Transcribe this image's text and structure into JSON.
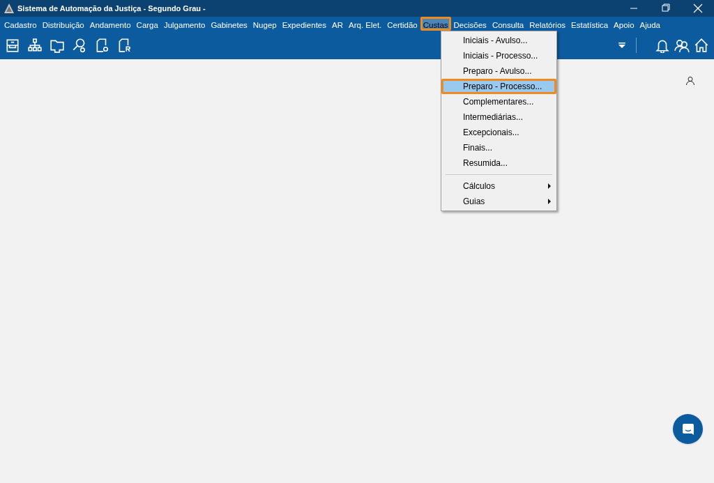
{
  "window": {
    "title": "Sistema de Automação da Justiça - Segundo Grau -"
  },
  "menubar": [
    {
      "label": "Cadastro",
      "selected": false,
      "highlighted": false
    },
    {
      "label": "Distribuição",
      "selected": false,
      "highlighted": false
    },
    {
      "label": "Andamento",
      "selected": false,
      "highlighted": false
    },
    {
      "label": "Carga",
      "selected": false,
      "highlighted": false
    },
    {
      "label": "Julgamento",
      "selected": false,
      "highlighted": false
    },
    {
      "label": "Gabinetes",
      "selected": false,
      "highlighted": false
    },
    {
      "label": "Nugep",
      "selected": false,
      "highlighted": false
    },
    {
      "label": "Expedientes",
      "selected": false,
      "highlighted": false
    },
    {
      "label": "AR",
      "selected": false,
      "highlighted": false
    },
    {
      "label": "Arq. Elet.",
      "selected": false,
      "highlighted": false
    },
    {
      "label": "Certidão",
      "selected": false,
      "highlighted": false
    },
    {
      "label": "Custas",
      "selected": true,
      "highlighted": true
    },
    {
      "label": "Decisões",
      "selected": false,
      "highlighted": false
    },
    {
      "label": "Consulta",
      "selected": false,
      "highlighted": false
    },
    {
      "label": "Relatórios",
      "selected": false,
      "highlighted": false
    },
    {
      "label": "Estatística",
      "selected": false,
      "highlighted": false
    },
    {
      "label": "Apoio",
      "selected": false,
      "highlighted": false
    },
    {
      "label": "Ajuda",
      "selected": false,
      "highlighted": false
    }
  ],
  "toolbar": {
    "left": [
      {
        "kind": "tray"
      },
      {
        "kind": "tree"
      },
      {
        "kind": "folder"
      },
      {
        "kind": "search-gear"
      },
      {
        "kind": "doc-o"
      },
      {
        "kind": "doc-r"
      }
    ],
    "right": [
      {
        "kind": "bell"
      },
      {
        "kind": "users"
      },
      {
        "kind": "home"
      }
    ]
  },
  "dropdown": [
    {
      "label": "Iniciais - Avulso...",
      "kind": "item",
      "selected": false,
      "highlighted": false,
      "separator_before": false
    },
    {
      "label": "Iniciais - Processo...",
      "kind": "item",
      "selected": false,
      "highlighted": false,
      "separator_before": false
    },
    {
      "label": "Preparo - Avulso...",
      "kind": "item",
      "selected": false,
      "highlighted": false,
      "separator_before": false
    },
    {
      "label": "Preparo - Processo...",
      "kind": "item",
      "selected": true,
      "highlighted": true,
      "separator_before": false
    },
    {
      "label": "Complementares...",
      "kind": "item",
      "selected": false,
      "highlighted": false,
      "separator_before": false
    },
    {
      "label": "Intermediárias...",
      "kind": "item",
      "selected": false,
      "highlighted": false,
      "separator_before": false
    },
    {
      "label": "Excepcionais...",
      "kind": "item",
      "selected": false,
      "highlighted": false,
      "separator_before": false
    },
    {
      "label": "Finais...",
      "kind": "item",
      "selected": false,
      "highlighted": false,
      "separator_before": false
    },
    {
      "label": "Resumida...",
      "kind": "item",
      "selected": false,
      "highlighted": false,
      "separator_before": false
    },
    {
      "label": "Cálculos",
      "kind": "submenu",
      "selected": false,
      "highlighted": false,
      "separator_before": true
    },
    {
      "label": "Guias",
      "kind": "submenu",
      "selected": false,
      "highlighted": false,
      "separator_before": false
    }
  ]
}
